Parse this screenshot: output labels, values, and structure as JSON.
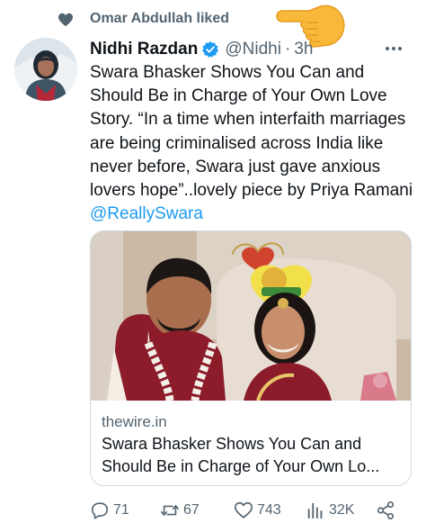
{
  "social_context": {
    "icon": "heart-icon",
    "text": "Omar Abdullah liked",
    "pointer": "pointing-hand-emoji"
  },
  "tweet": {
    "author": {
      "display_name": "Nidhi Razdan",
      "handle": "@Nidhi",
      "verified": true,
      "avatar": "avatar-photo"
    },
    "separator": "·",
    "time": "3h",
    "text_parts": {
      "body": "Swara Bhasker Shows You Can and Should Be in Charge of Your Own Love Story. “In a time when interfaith marriages are being criminalised across India like never before, Swara just gave anxious lovers hope”..lovely piece by Priya Ramani ",
      "mention": "@ReallySwara"
    }
  },
  "card": {
    "image": "wedding-photo",
    "domain": "thewire.in",
    "title": "Swara Bhasker Shows You Can and Should Be in Charge of Your Own Lo..."
  },
  "actions": {
    "reply": "71",
    "retweet": "67",
    "like": "743",
    "views": "32K",
    "share_icon": "share-icon"
  },
  "colors": {
    "accent": "#1d9bf0",
    "secondary_text": "#536471",
    "border": "#cfd9de"
  }
}
